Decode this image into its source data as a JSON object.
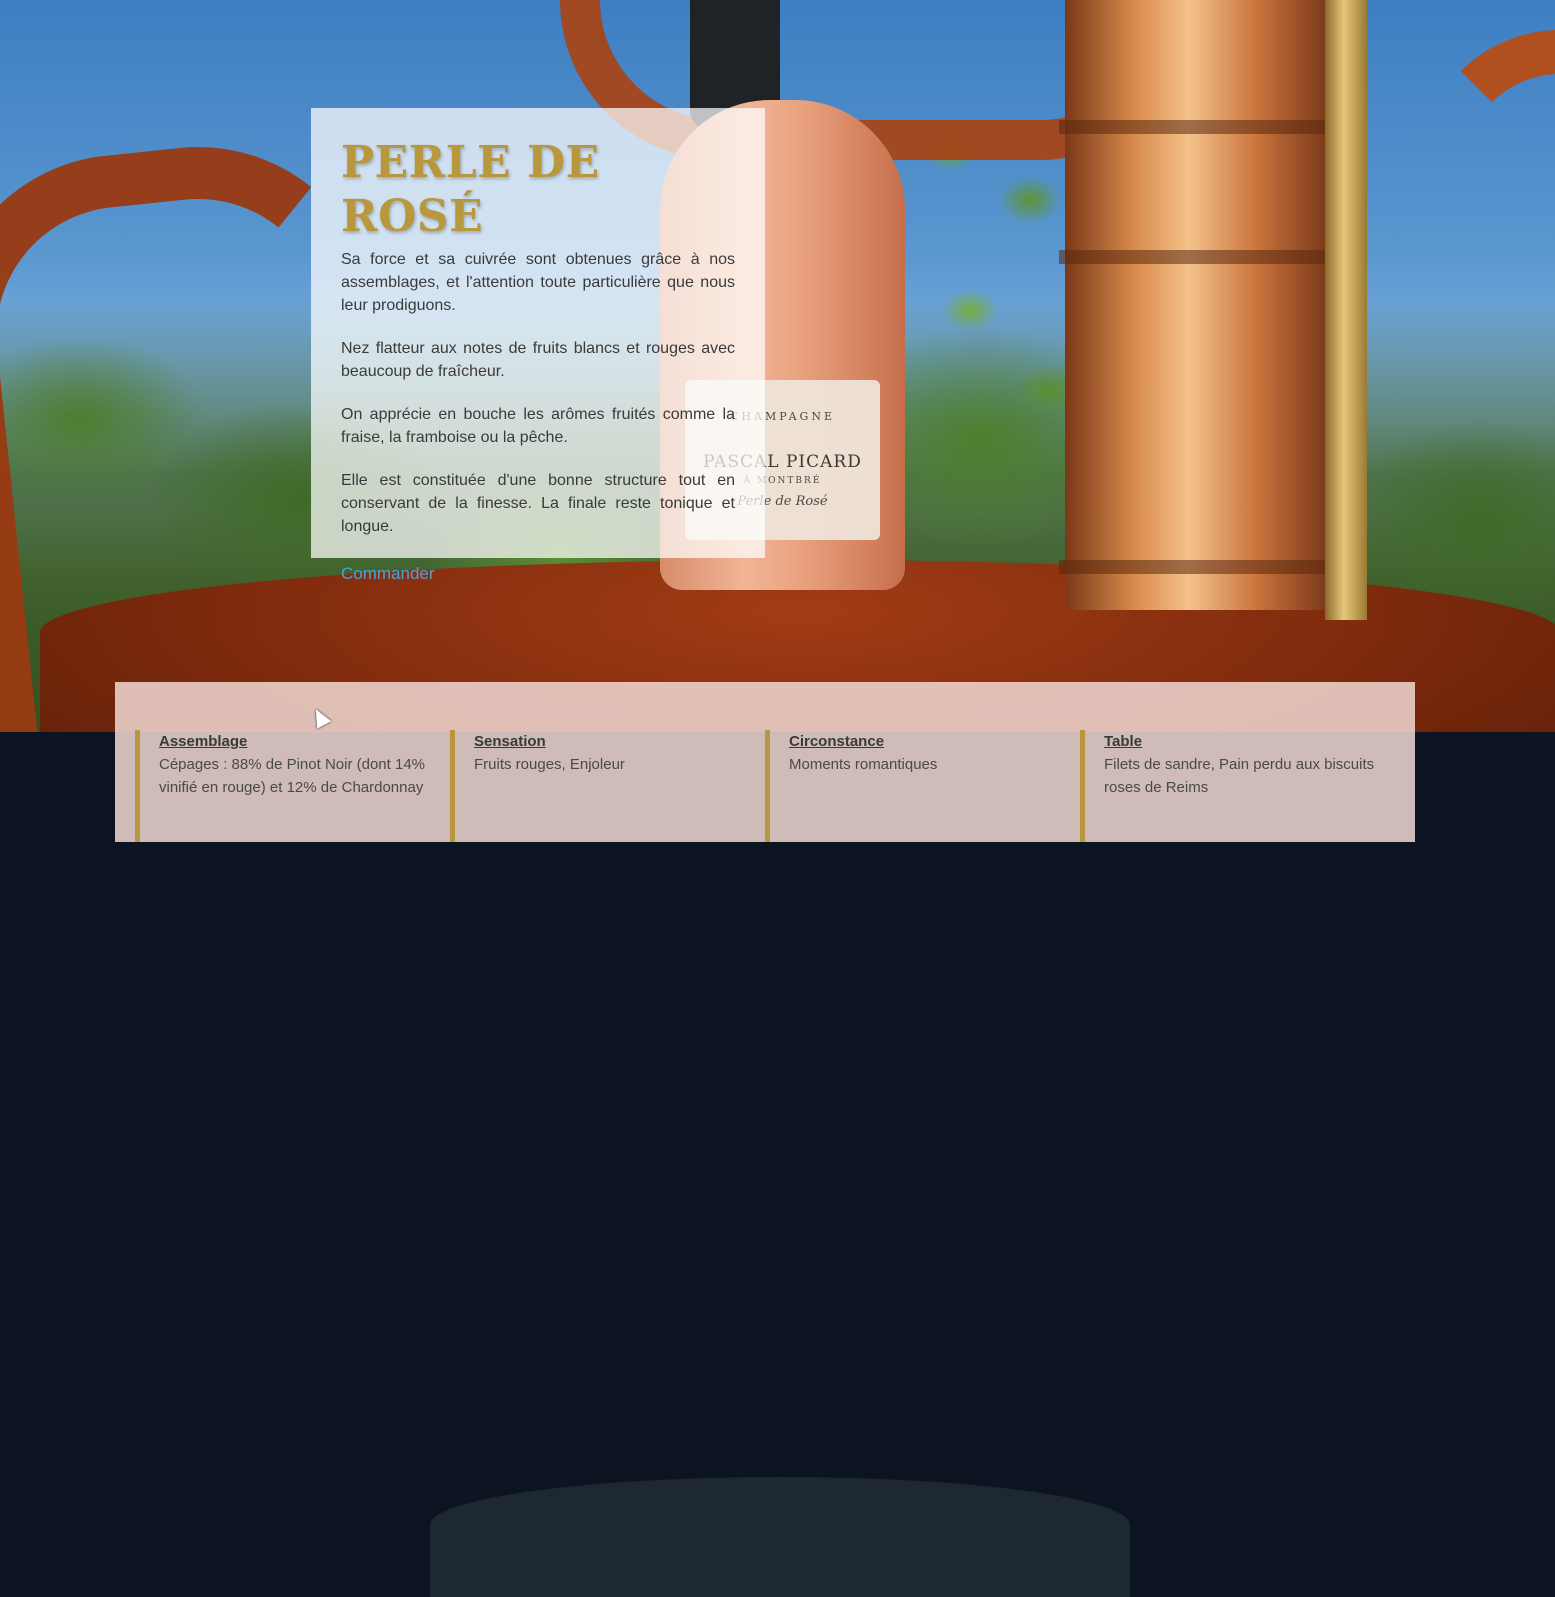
{
  "card": {
    "title": "PERLE DE ROSÉ",
    "paragraphs": [
      "Sa force et sa cuivrée sont obtenues grâce à nos assemblages, et l'attention toute particulière que nous leur prodiguons.",
      "Nez flatteur aux notes de fruits blancs et rouges avec beaucoup de fraîcheur.",
      "On apprécie en bouche les arômes fruités comme la fraise, la framboise ou la pêche.",
      "Elle est constituée d'une bonne structure tout en conservant de la finesse. La finale reste tonique et longue."
    ],
    "order_link": "Commander"
  },
  "info": {
    "columns": [
      {
        "heading": "Assemblage",
        "value": "Cépages : 88% de Pinot Noir (dont 14% vinifié en rouge) et 12% de Chardonnay"
      },
      {
        "heading": "Sensation",
        "value": "Fruits rouges, Enjoleur"
      },
      {
        "heading": "Circonstance",
        "value": "Moments romantiques"
      },
      {
        "heading": "Table",
        "value": "Filets de sandre, Pain perdu aux biscuits roses de Reims"
      }
    ]
  },
  "bottle_label": {
    "brand": "PASCAL PICARD",
    "line1": "CHAMPAGNE",
    "line2": "À MONTBRÉ",
    "cuvee": "Perle de Rosé"
  },
  "colors": {
    "title_gold": "#b8973d",
    "link_blue": "#4aa2d9",
    "accent_border": "#b8973d"
  }
}
